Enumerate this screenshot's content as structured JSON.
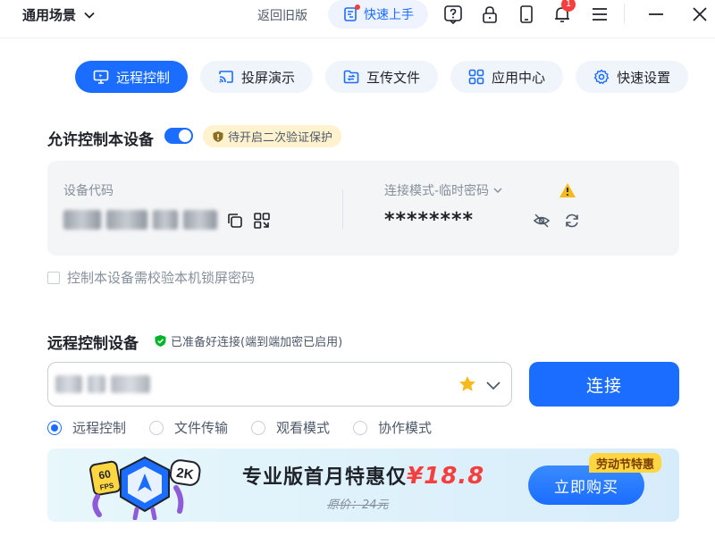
{
  "titlebar": {
    "scene_label": "通用场景",
    "old_version": "返回旧版",
    "quickstart": "快速上手",
    "notification_count": "1"
  },
  "tabs": [
    {
      "label": "远程控制",
      "icon": "monitor-icon",
      "active": true
    },
    {
      "label": "投屏演示",
      "icon": "cast-icon",
      "active": false
    },
    {
      "label": "互传文件",
      "icon": "folder-transfer-icon",
      "active": false
    },
    {
      "label": "应用中心",
      "icon": "apps-icon",
      "active": false
    },
    {
      "label": "快速设置",
      "icon": "gear-icon",
      "active": false
    }
  ],
  "allow": {
    "title": "允许控制本设备",
    "toggle_on": true,
    "warning": "待开启二次验证保护"
  },
  "device_card": {
    "code_label": "设备代码",
    "mode_label": "连接模式-临时密码",
    "password_masked": "********"
  },
  "lock_checkbox": {
    "label": "控制本设备需校验本机锁屏密码",
    "checked": false
  },
  "remote": {
    "title": "远程控制设备",
    "status": "已准备好连接(端到端加密已启用)",
    "connect_label": "连接"
  },
  "modes": [
    {
      "label": "远程控制",
      "selected": true
    },
    {
      "label": "文件传输",
      "selected": false
    },
    {
      "label": "观看模式",
      "selected": false
    },
    {
      "label": "协作模式",
      "selected": false
    }
  ],
  "promo": {
    "headline": "专业版首月特惠仅",
    "price": "¥18.8",
    "original_price": "原价：24元",
    "buy_label": "立即购买",
    "tag": "劳动节特惠",
    "fps_badge": "60",
    "fps_unit": "FPS",
    "resolution_badge": "2K"
  },
  "colors": {
    "accent": "#1a6dff",
    "warning_bg": "#fff3cf",
    "success": "#00b42a",
    "price": "#f53f3f"
  }
}
